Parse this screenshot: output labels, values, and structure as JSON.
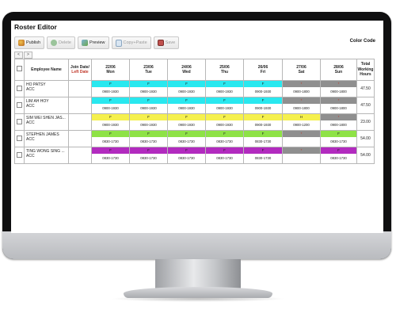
{
  "app": {
    "title": "Roster Editor",
    "color_code_label": "Color Code"
  },
  "toolbar": {
    "publish": "Publish",
    "delete": "Delete",
    "preview": "Preview",
    "copy_paste": "Copy+Paste",
    "save": "Save"
  },
  "nav": {
    "prev": "<",
    "next": ">"
  },
  "headers": {
    "employee": "Employee Name",
    "join_date_1": "Join Date/",
    "join_date_2": "Left Date",
    "total": "Total Working Hours",
    "days": [
      {
        "date": "22/06",
        "day": "Mon",
        "weekend": false
      },
      {
        "date": "23/06",
        "day": "Tue",
        "weekend": false
      },
      {
        "date": "24/06",
        "day": "Wed",
        "weekend": false
      },
      {
        "date": "25/06",
        "day": "Thu",
        "weekend": false
      },
      {
        "date": "26/06",
        "day": "Fri",
        "weekend": false
      },
      {
        "date": "27/06",
        "day": "Sat",
        "weekend": false
      },
      {
        "date": "28/06",
        "day": "Sun",
        "weekend": true
      }
    ]
  },
  "colors": {
    "cyan": "#29e8ef",
    "gray": "#8f8f8f",
    "yellow": "#f5f04d",
    "green": "#8ee246",
    "purple": "#b22bbf"
  },
  "rows": [
    {
      "name": "HO PATSY",
      "dept": "ACC",
      "total": "47.50",
      "shifts": [
        {
          "code": "F",
          "time": "0900-1930",
          "color": "cyan"
        },
        {
          "code": "F",
          "time": "0900-1930",
          "color": "cyan"
        },
        {
          "code": "F",
          "time": "0900-1930",
          "color": "cyan"
        },
        {
          "code": "F",
          "time": "0900-1930",
          "color": "cyan"
        },
        {
          "code": "F",
          "time": "0900-1930",
          "color": "cyan"
        },
        {
          "code": "*",
          "time": "0900-1800",
          "color": "gray"
        },
        {
          "code": "*",
          "time": "0900-1800",
          "color": "gray"
        }
      ]
    },
    {
      "name": "LIM AH HOY",
      "dept": "ACC",
      "total": "47.50",
      "shifts": [
        {
          "code": "F",
          "time": "0900-1930",
          "color": "cyan"
        },
        {
          "code": "F",
          "time": "0900-1930",
          "color": "cyan"
        },
        {
          "code": "F",
          "time": "0900-1930",
          "color": "cyan"
        },
        {
          "code": "F",
          "time": "0900-1930",
          "color": "cyan"
        },
        {
          "code": "F",
          "time": "0900-1930",
          "color": "cyan"
        },
        {
          "code": "*",
          "time": "0900-1800",
          "color": "gray"
        },
        {
          "code": "*",
          "time": "0900-1800",
          "color": "gray"
        }
      ]
    },
    {
      "name": "SIM WEI SHEN JAS...",
      "dept": "ACC",
      "total": "23.00",
      "shifts": [
        {
          "code": "F",
          "time": "0900-1930",
          "color": "yellow"
        },
        {
          "code": "F",
          "time": "0900-1930",
          "color": "yellow"
        },
        {
          "code": "F",
          "time": "0900-1930",
          "color": "yellow"
        },
        {
          "code": "F",
          "time": "0900-1930",
          "color": "yellow"
        },
        {
          "code": "F",
          "time": "0900-1930",
          "color": "yellow"
        },
        {
          "code": "H",
          "time": "0900-1200",
          "color": "yellow"
        },
        {
          "code": "*",
          "time": "0900-1800",
          "color": "gray"
        }
      ]
    },
    {
      "name": "STEPHEN JAMES",
      "dept": "ACC",
      "total": "54.00",
      "shifts": [
        {
          "code": "F",
          "time": "0830-1730",
          "color": "green"
        },
        {
          "code": "F",
          "time": "0830-1730",
          "color": "green"
        },
        {
          "code": "F",
          "time": "0830-1730",
          "color": "green"
        },
        {
          "code": "F",
          "time": "0830-1730",
          "color": "green"
        },
        {
          "code": "F",
          "time": "0830-1730",
          "color": "green"
        },
        {
          "code": "*",
          "time": "",
          "color": "gray"
        },
        {
          "code": "F",
          "time": "0830-1730",
          "color": "green"
        }
      ]
    },
    {
      "name": "TING WONG SING ...",
      "dept": "ACC",
      "total": "54.00",
      "shifts": [
        {
          "code": "F",
          "time": "0830-1730",
          "color": "purple"
        },
        {
          "code": "F",
          "time": "0830-1730",
          "color": "purple"
        },
        {
          "code": "F",
          "time": "0830-1730",
          "color": "purple"
        },
        {
          "code": "F",
          "time": "0830-1730",
          "color": "purple"
        },
        {
          "code": "F",
          "time": "0830-1730",
          "color": "purple"
        },
        {
          "code": "*",
          "time": "",
          "color": "gray"
        },
        {
          "code": "F",
          "time": "0830-1730",
          "color": "purple"
        }
      ]
    }
  ]
}
